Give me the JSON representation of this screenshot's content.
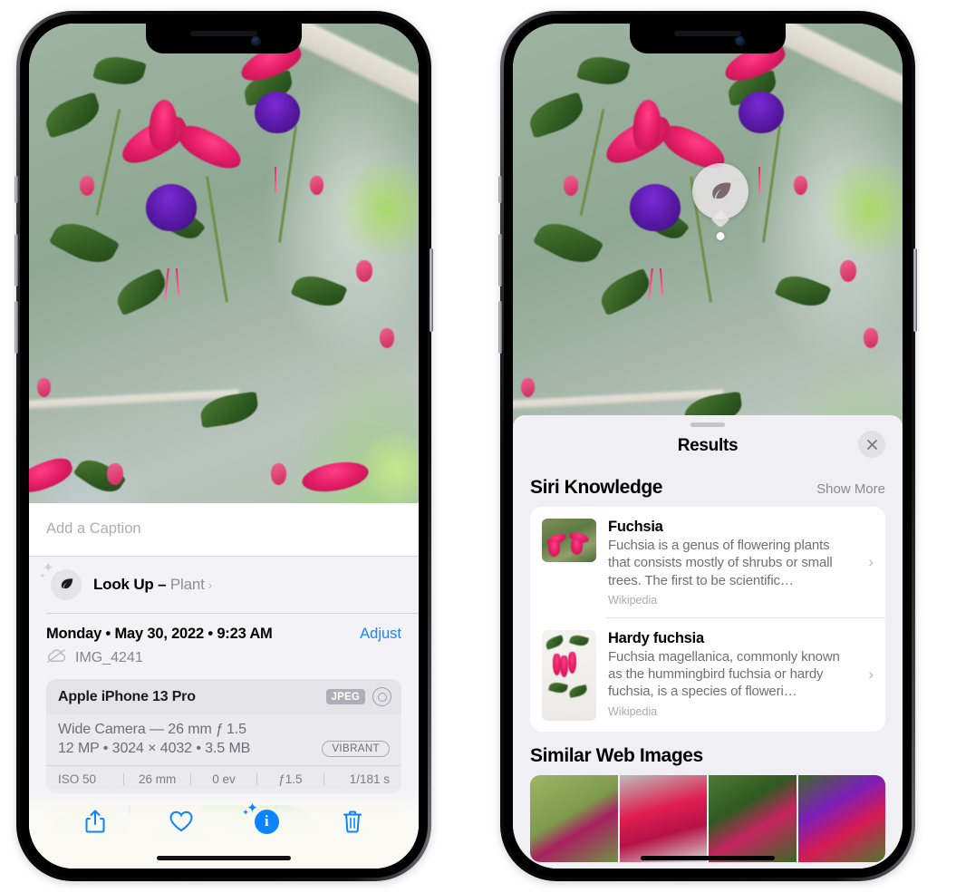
{
  "left_phone": {
    "photo": {
      "alt_name": "fuchsia-flowers-photo"
    },
    "caption": {
      "placeholder": "Add a Caption",
      "value": ""
    },
    "look_up": {
      "label": "Look Up",
      "dash": "–",
      "subject": "Plant",
      "icon": "leaf-icon",
      "chevron": "›"
    },
    "meta": {
      "date_line": "Monday • May 30, 2022 • 9:23 AM",
      "adjust_label": "Adjust",
      "filename": "IMG_4241",
      "cloud_icon": "icloud-slash-icon"
    },
    "exif": {
      "device": "Apple iPhone 13 Pro",
      "format_badge": "JPEG",
      "aperture_icon": "aperture-icon",
      "lens": "Wide Camera — 26 mm ƒ 1.5",
      "size_line": "12 MP • 3024 × 4032 • 3.5 MB",
      "style_badge": "VIBRANT",
      "stats": [
        "ISO 50",
        "26 mm",
        "0 ev",
        "ƒ1.5",
        "1/181 s"
      ]
    },
    "map": {
      "name": "photo-location-map"
    },
    "toolbar": [
      {
        "name": "share-button",
        "icon": "share-icon"
      },
      {
        "name": "favorite-button",
        "icon": "heart-icon"
      },
      {
        "name": "info-button",
        "icon": "info-sparkle-icon",
        "glyph": "i"
      },
      {
        "name": "delete-button",
        "icon": "trash-icon"
      }
    ]
  },
  "right_phone": {
    "visual_lookup_badge": {
      "icon": "leaf-icon",
      "name": "visual-look-up-badge"
    },
    "sheet": {
      "title": "Results",
      "close_icon": "close-icon",
      "grabber": "drag-handle"
    },
    "siri_knowledge": {
      "section_title": "Siri Knowledge",
      "show_more": "Show More",
      "items": [
        {
          "title": "Fuchsia",
          "description": "Fuchsia is a genus of flowering plants that consists mostly of shrubs or small trees. The first to be scientific…",
          "source": "Wikipedia",
          "chevron": "›"
        },
        {
          "title": "Hardy fuchsia",
          "description": "Fuchsia magellanica, commonly known as the hummingbird fuchsia or hardy fuchsia, is a species of floweri…",
          "source": "Wikipedia",
          "chevron": "›"
        }
      ]
    },
    "similar_web_images": {
      "section_title": "Similar Web Images",
      "thumbnails": [
        {
          "name": "web-image-1"
        },
        {
          "name": "web-image-2"
        },
        {
          "name": "web-image-3"
        },
        {
          "name": "web-image-4"
        }
      ]
    }
  },
  "colors": {
    "accent_blue": "#0a84ff",
    "link_blue": "#1c84ff",
    "sheet_gray": "#f0eff4",
    "info_gray": "#f2f2f7",
    "secondary_text": "#8e8e93"
  }
}
